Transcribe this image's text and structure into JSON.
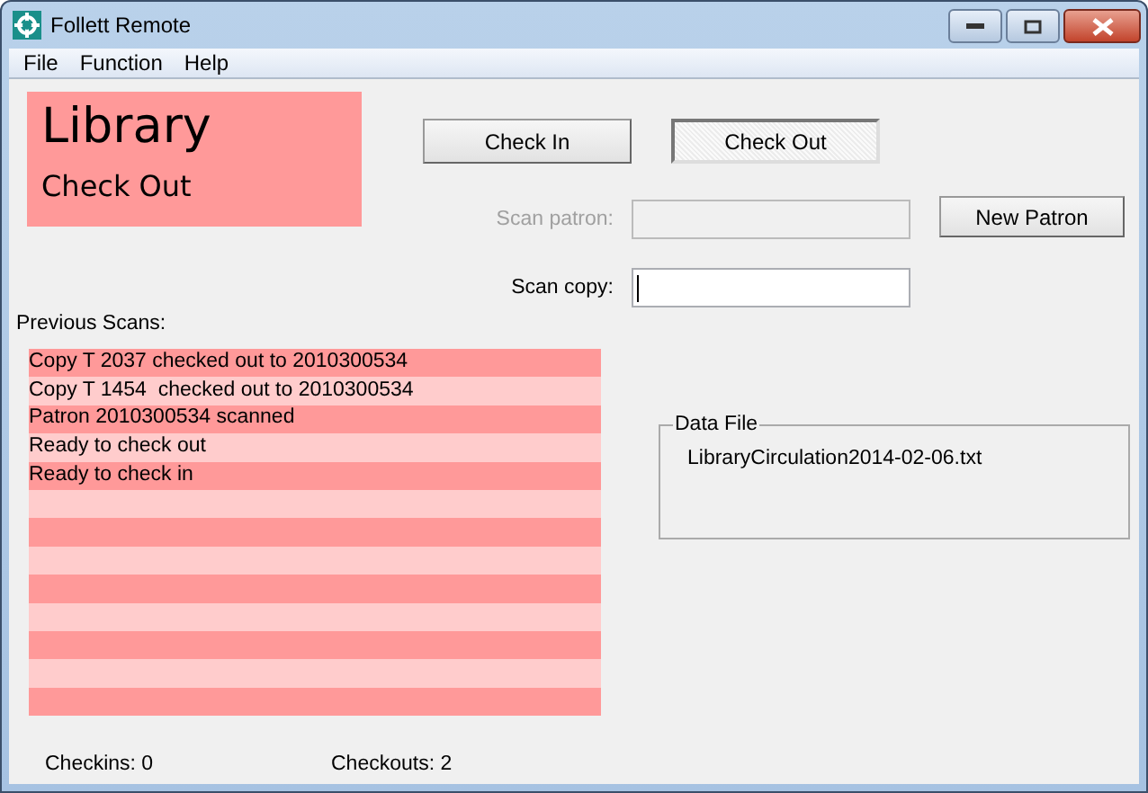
{
  "window": {
    "title": "Follett Remote"
  },
  "menu": [
    "File",
    "Function",
    "Help"
  ],
  "banner": {
    "title": "Library",
    "subtitle": "Check Out"
  },
  "mode_buttons": [
    {
      "label": "Check In",
      "selected": false
    },
    {
      "label": "Check Out",
      "selected": true
    }
  ],
  "scan_patron": {
    "label": "Scan patron:",
    "disabled": true
  },
  "new_patron_button": "New Patron",
  "scan_copy": {
    "label": "Scan copy:",
    "disabled": false
  },
  "previous_scans": {
    "label": "Previous Scans:",
    "rows": [
      "Copy T 2037 checked out to 2010300534",
      "Copy T 1454  checked out to 2010300534",
      "Patron 2010300534 scanned",
      "Ready to check out",
      "Ready to check in"
    ]
  },
  "data_file": {
    "title": "Data File",
    "filename": "LibraryCirculation2014-02-06.txt"
  },
  "status": {
    "checkins": "Checkins: 0",
    "checkouts": "Checkouts: 2"
  }
}
